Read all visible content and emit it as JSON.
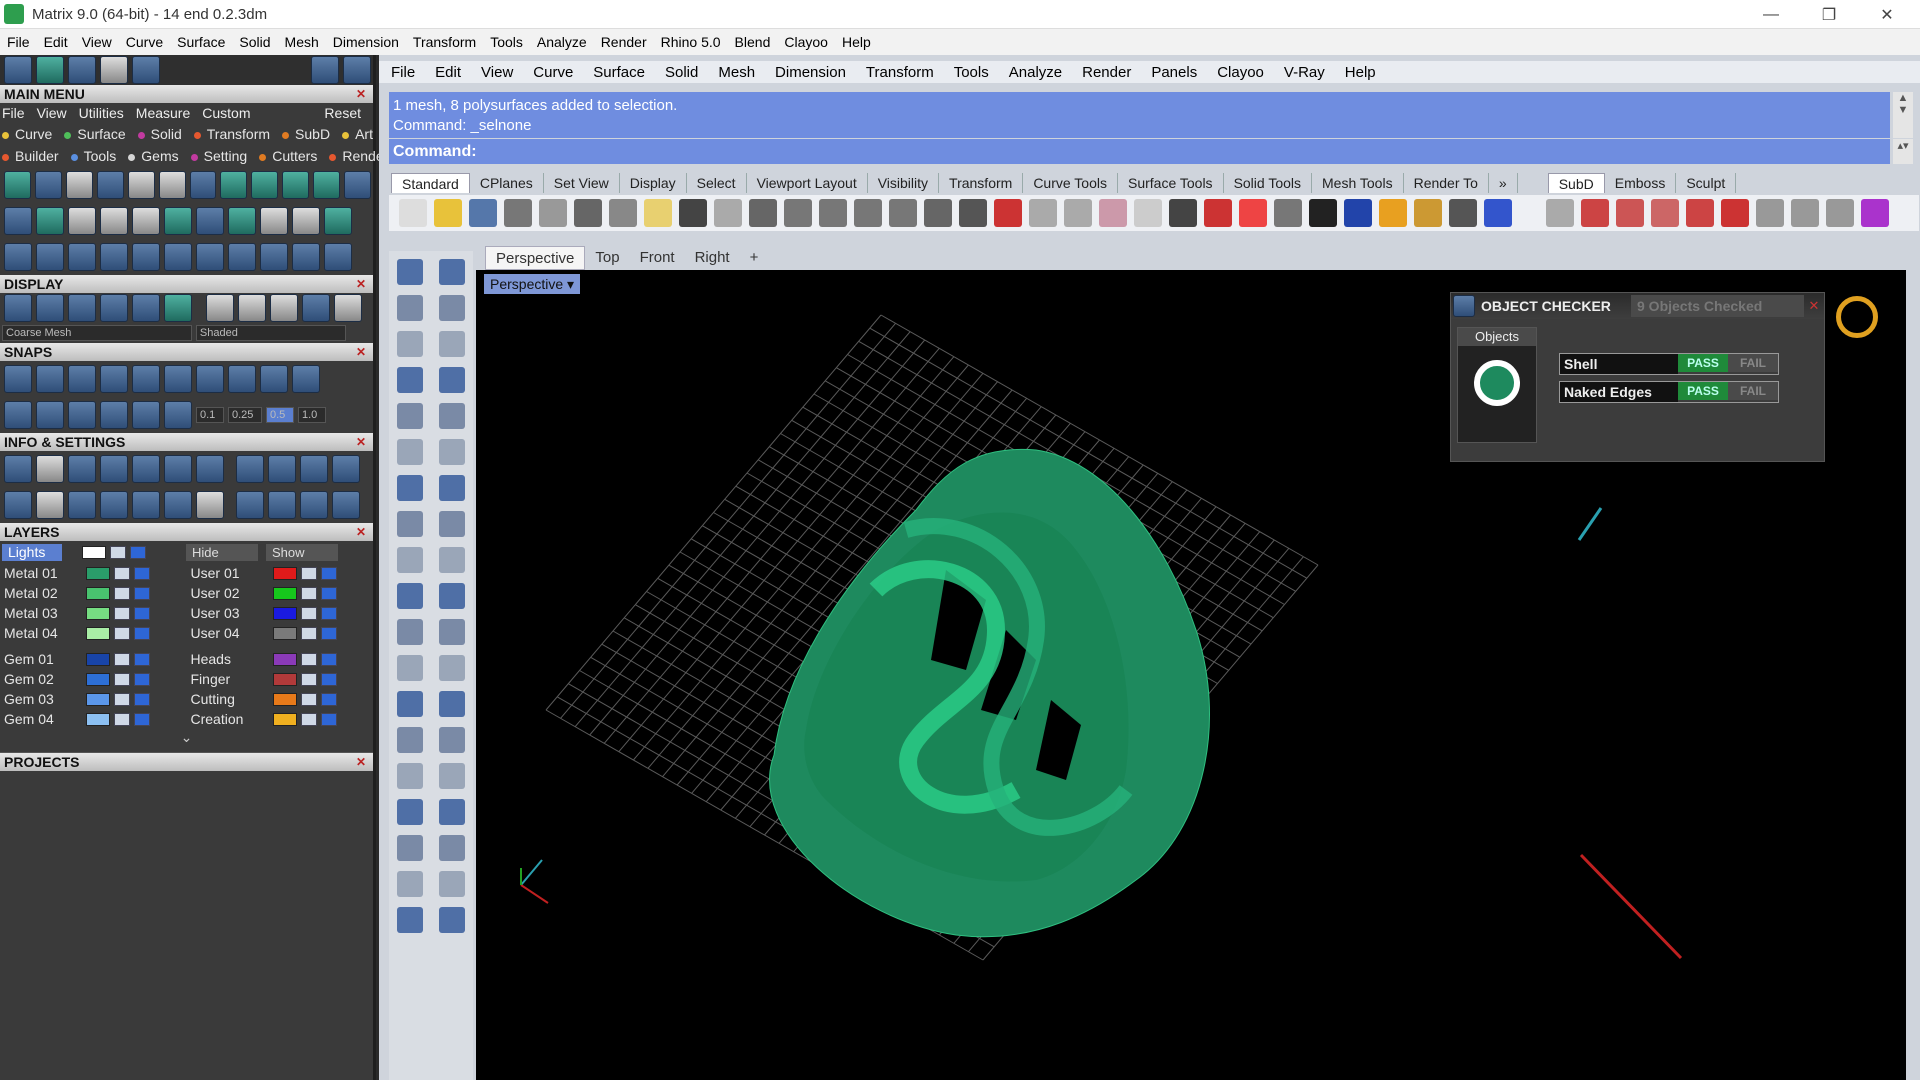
{
  "window": {
    "title": "Matrix 9.0 (64-bit) - 14 end   0.2.3dm",
    "minimize": "—",
    "maximize": "❐",
    "close": "✕"
  },
  "menubar": [
    "File",
    "Edit",
    "View",
    "Curve",
    "Surface",
    "Solid",
    "Mesh",
    "Dimension",
    "Transform",
    "Tools",
    "Analyze",
    "Render",
    "Rhino 5.0",
    "Blend",
    "Clayoo",
    "Help"
  ],
  "left": {
    "main_menu": {
      "title": "MAIN MENU",
      "menu": [
        "File",
        "View",
        "Utilities",
        "Measure",
        "Custom"
      ],
      "reset": "Reset",
      "row1": [
        {
          "label": "Curve",
          "color": "#e8c23a"
        },
        {
          "label": "Surface",
          "color": "#4fbf5a"
        },
        {
          "label": "Solid",
          "color": "#c23aa0"
        },
        {
          "label": "Transform",
          "color": "#e6582f"
        },
        {
          "label": "SubD",
          "color": "#e07b22"
        },
        {
          "label": "Art",
          "color": "#e8c23a"
        }
      ],
      "row2": [
        {
          "label": "Builder",
          "color": "#e6582f"
        },
        {
          "label": "Tools",
          "color": "#5a8fe0"
        },
        {
          "label": "Gems",
          "color": "#d6d6d6"
        },
        {
          "label": "Setting",
          "color": "#c23aa0"
        },
        {
          "label": "Cutters",
          "color": "#e07b22"
        },
        {
          "label": "Render",
          "color": "#e6582f"
        }
      ]
    },
    "display": {
      "title": "DISPLAY",
      "mesh": "Coarse Mesh",
      "mode": "Shaded"
    },
    "snaps": {
      "title": "SNAPS",
      "values": [
        "0.1",
        "0.25",
        "0.5",
        "1.0"
      ]
    },
    "info": {
      "title": "INFO & SETTINGS"
    },
    "layers": {
      "title": "LAYERS",
      "lights": "Lights",
      "hide": "Hide",
      "show": "Show",
      "left": [
        {
          "name": "Metal 01",
          "color": "#2a9d6a"
        },
        {
          "name": "Metal 02",
          "color": "#49c36f"
        },
        {
          "name": "Metal 03",
          "color": "#76dd82"
        },
        {
          "name": "Metal 04",
          "color": "#a9eea6"
        },
        {
          "name": "Gem 01",
          "color": "#1844a8"
        },
        {
          "name": "Gem 02",
          "color": "#2d6fd6"
        },
        {
          "name": "Gem 03",
          "color": "#5b97ea"
        },
        {
          "name": "Gem 04",
          "color": "#8cc0f2"
        }
      ],
      "right": [
        {
          "name": "User 01",
          "color": "#e01a1a"
        },
        {
          "name": "User 02",
          "color": "#16c81c"
        },
        {
          "name": "User 03",
          "color": "#1a1ae0"
        },
        {
          "name": "User 04",
          "color": "#7a7a7a"
        },
        {
          "name": "Heads",
          "color": "#8b3ab8"
        },
        {
          "name": "Finger",
          "color": "#b23a3a"
        },
        {
          "name": "Cutting",
          "color": "#e87a1a"
        },
        {
          "name": "Creation",
          "color": "#f0b020"
        }
      ]
    },
    "projects": {
      "title": "PROJECTS"
    }
  },
  "rhino": {
    "menu": [
      "File",
      "Edit",
      "View",
      "Curve",
      "Surface",
      "Solid",
      "Mesh",
      "Dimension",
      "Transform",
      "Tools",
      "Analyze",
      "Render",
      "Panels",
      "Clayoo",
      "V-Ray",
      "Help"
    ],
    "history": [
      "1 mesh, 8 polysurfaces added to selection.",
      "Command: _selnone"
    ],
    "command_label": "Command:",
    "tabs": [
      "Standard",
      "CPlanes",
      "Set View",
      "Display",
      "Select",
      "Viewport Layout",
      "Visibility",
      "Transform",
      "Curve Tools",
      "Surface Tools",
      "Solid Tools",
      "Mesh Tools",
      "Render To"
    ],
    "tabs_more": "»",
    "tabs2": [
      "SubD",
      "Emboss",
      "Sculpt"
    ],
    "viewport_tabs": [
      "Perspective",
      "Top",
      "Front",
      "Right",
      "+"
    ],
    "viewport_label": "Perspective"
  },
  "checker": {
    "title": "OBJECT CHECKER",
    "count_text": "9  Objects Checked",
    "objects_label": "Objects",
    "rows": [
      {
        "label": "Shell",
        "pass": "PASS",
        "fail": "FAIL"
      },
      {
        "label": "Naked Edges",
        "pass": "PASS",
        "fail": "FAIL"
      }
    ]
  },
  "colors": {
    "accent": "#6f8de0",
    "mesh": "#1e8a5e",
    "pass": "#1f8a3a"
  }
}
